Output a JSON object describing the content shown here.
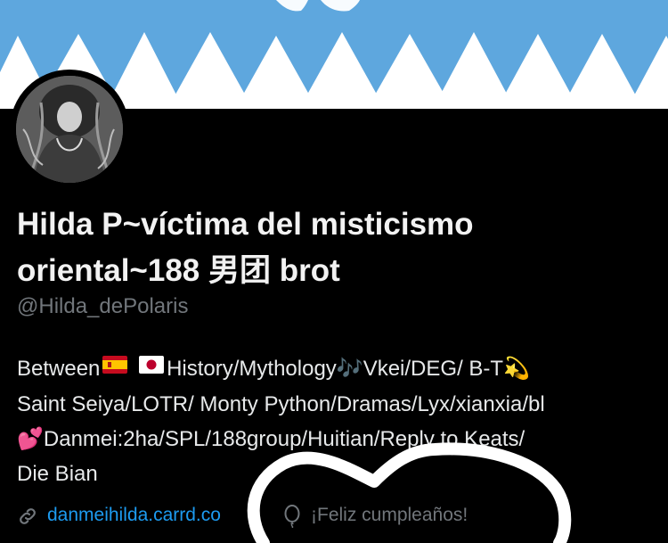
{
  "profile": {
    "display_name_line1": "Hilda P~víctima del misticismo",
    "display_name_line2": "oriental~188 男团 brot",
    "handle": "@Hilda_dePolaris",
    "bio": {
      "line1_a": "Between",
      "line1_b": "History/Mythology",
      "line1_c": "🎶",
      "line1_d": "Vkei/DEG/ B-T",
      "line1_e": "💫",
      "line2": "Saint Seiya/LOTR/ Monty Python/Dramas/Lyx/xianxia/bl",
      "line3_icon": "💕",
      "line3": "Danmei:2ha/SPL/188group/Huitian/Reply to Keats/",
      "line4": "Die Bian"
    },
    "flags": [
      "spain-flag",
      "japan-flag"
    ],
    "website": "danmeihilda.carrd.co",
    "birthday": "¡Feliz cumpleaños!"
  },
  "colors": {
    "banner": "#5ea7de",
    "background": "#000000",
    "link": "#1d9bf0",
    "muted": "#71767b"
  },
  "icons": [
    "link-icon",
    "balloon-icon"
  ]
}
